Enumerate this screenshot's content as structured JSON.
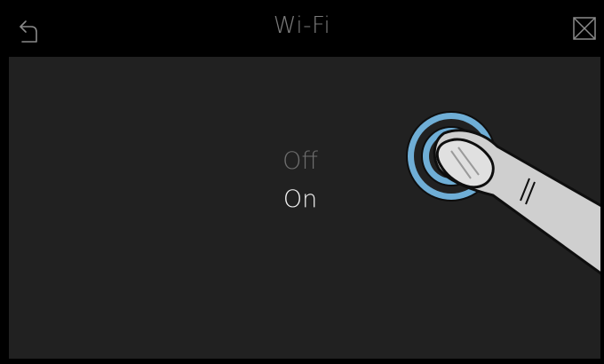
{
  "header": {
    "title": "Wi-Fi",
    "back_icon": "back-arrow-icon",
    "close_icon": "close-icon"
  },
  "options": {
    "off_label": "Off",
    "on_label": "On",
    "selected": "On"
  },
  "gesture": {
    "type": "tap",
    "icon": "finger-tap-icon",
    "ring_color": "#6faed6"
  },
  "colors": {
    "background": "#000000",
    "panel": "#212121",
    "selected_text": "#f2f2f2",
    "unselected_text": "#6e6e6e",
    "title_text": "#7a7a7a"
  }
}
